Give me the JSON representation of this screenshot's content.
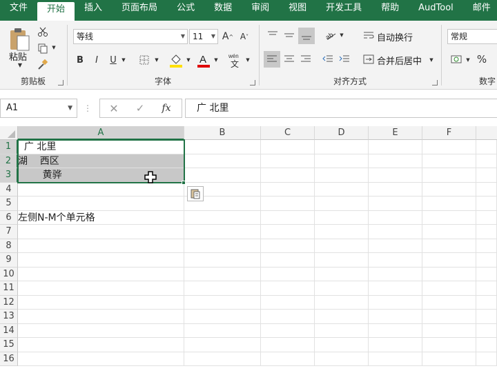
{
  "tabs": [
    "文件",
    "开始",
    "插入",
    "页面布局",
    "公式",
    "数据",
    "审阅",
    "视图",
    "开发工具",
    "帮助",
    "AudTool",
    "邮件"
  ],
  "active_tab": "开始",
  "clipboard": {
    "paste_label": "粘贴",
    "group_label": "剪贴板"
  },
  "font": {
    "name": "等线",
    "size": "11",
    "group_label": "字体"
  },
  "alignment": {
    "wrap_label": "自动换行",
    "merge_label": "合并后居中",
    "group_label": "对齐方式"
  },
  "number": {
    "format": "常规",
    "group_label": "数字"
  },
  "formula_bar": {
    "name_box": "A1",
    "content": "广 北里"
  },
  "columns": [
    "A",
    "B",
    "C",
    "D",
    "E",
    "F"
  ],
  "rows": [
    "1",
    "2",
    "3",
    "4",
    "5",
    "6",
    "7",
    "8",
    "9",
    "10",
    "11",
    "12",
    "13",
    "14",
    "15",
    "16"
  ],
  "cells": {
    "a1": "  广 北里",
    "a2": "湖    西区",
    "a3": "        黄骅",
    "a6": "左侧N-M个单元格"
  },
  "colors": {
    "accent": "#217346",
    "selection": "#c8c8c8"
  },
  "icons": [
    "scissors-icon",
    "copy-icon",
    "format-painter-icon",
    "paste-icon",
    "bold-icon",
    "italic-icon",
    "underline-icon",
    "borders-icon",
    "fill-color-icon",
    "font-color-icon",
    "phonetic-icon",
    "align-left-icon",
    "cross-cursor-icon",
    "paste-options-icon"
  ]
}
